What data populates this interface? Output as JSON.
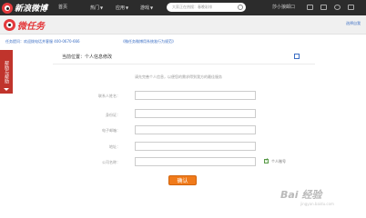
{
  "topbar": {
    "logo_text": "新浪微博",
    "nav": [
      {
        "label": "首页"
      },
      {
        "label": "热门"
      },
      {
        "label": "应用"
      },
      {
        "label": "游戏"
      }
    ],
    "search_placeholder": "大家正在热搜：春晚彩排",
    "user_name": "莎小狼邮口"
  },
  "header": {
    "task_logo_text": "微任务",
    "top_right_link": "选择自我"
  },
  "subline": {
    "left": "任务提问：欢迎拨电话并客服 400-0670-666",
    "right": "《微任务微博用系统准行为规范》"
  },
  "sidebar": {
    "tab_label": "帮助与帮助"
  },
  "page": {
    "breadcrumb": "当前位置：个人信息修改",
    "notice": "请先完善个人信息，以便您的需求得到我方的最佳服务",
    "form": {
      "fields": [
        {
          "label": "联系人姓名："
        },
        {
          "label": "身份证："
        },
        {
          "label": "电子邮箱："
        },
        {
          "label": "地址："
        },
        {
          "label": "公司名称："
        }
      ],
      "checkbox_label": "个人账号",
      "submit_label": "确认"
    }
  },
  "watermark": {
    "text": "Bai 经验",
    "sub": "jingyan.baidu.com"
  }
}
